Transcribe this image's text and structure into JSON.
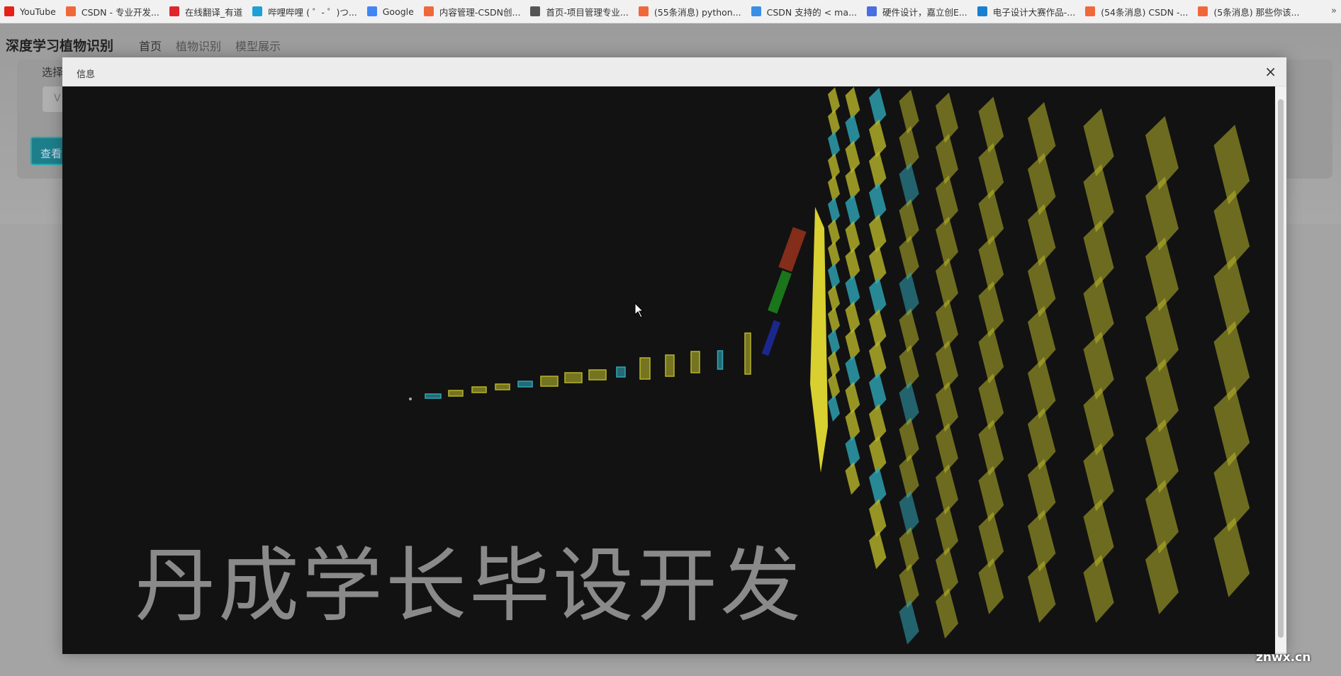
{
  "bookmarks": [
    {
      "label": "YouTube",
      "icon": "youtube-icon",
      "color": "#e62117"
    },
    {
      "label": "CSDN - 专业开发...",
      "icon": "csdn-icon",
      "color": "#f0683a"
    },
    {
      "label": "在线翻译_有道",
      "icon": "youdao-icon",
      "color": "#e0252b"
    },
    {
      "label": "哔哩哔哩 ( ゜- ゜)つ...",
      "icon": "bilibili-icon",
      "color": "#1da0d6"
    },
    {
      "label": "Google",
      "icon": "google-icon",
      "color": "#4285f4"
    },
    {
      "label": "内容管理-CSDN创...",
      "icon": "csdn-icon",
      "color": "#f0683a"
    },
    {
      "label": "首页-项目管理专业...",
      "icon": "globe-icon",
      "color": "#555555"
    },
    {
      "label": "(55条消息) python...",
      "icon": "csdn-icon",
      "color": "#f0683a"
    },
    {
      "label": "CSDN 支持的 < ma...",
      "icon": "cloud-icon",
      "color": "#3a8ee6"
    },
    {
      "label": "硬件设计，嘉立创E...",
      "icon": "lceda-icon",
      "color": "#4a6ee0"
    },
    {
      "label": "电子设计大赛作品-...",
      "icon": "lc-icon",
      "color": "#1780d0"
    },
    {
      "label": "(54条消息) CSDN -...",
      "icon": "csdn-icon",
      "color": "#f0683a"
    },
    {
      "label": "(5条消息) 那些你该...",
      "icon": "csdn-icon",
      "color": "#f0683a"
    }
  ],
  "bookmarks_more": "»",
  "navbar": {
    "brand": "深度学习植物识别",
    "links": [
      "首页",
      "植物识别",
      "模型展示"
    ]
  },
  "page": {
    "select_label": "选择",
    "input_value": "V",
    "button_label": "查看"
  },
  "modal": {
    "title": "信息",
    "close": "×"
  },
  "visual": {
    "watermark": "丹成学长毕设开发",
    "colors": {
      "yellow": "#b8b52a",
      "cyan": "#2fa6b8",
      "background": "#121212"
    }
  },
  "site_watermark": "znwx.cn"
}
